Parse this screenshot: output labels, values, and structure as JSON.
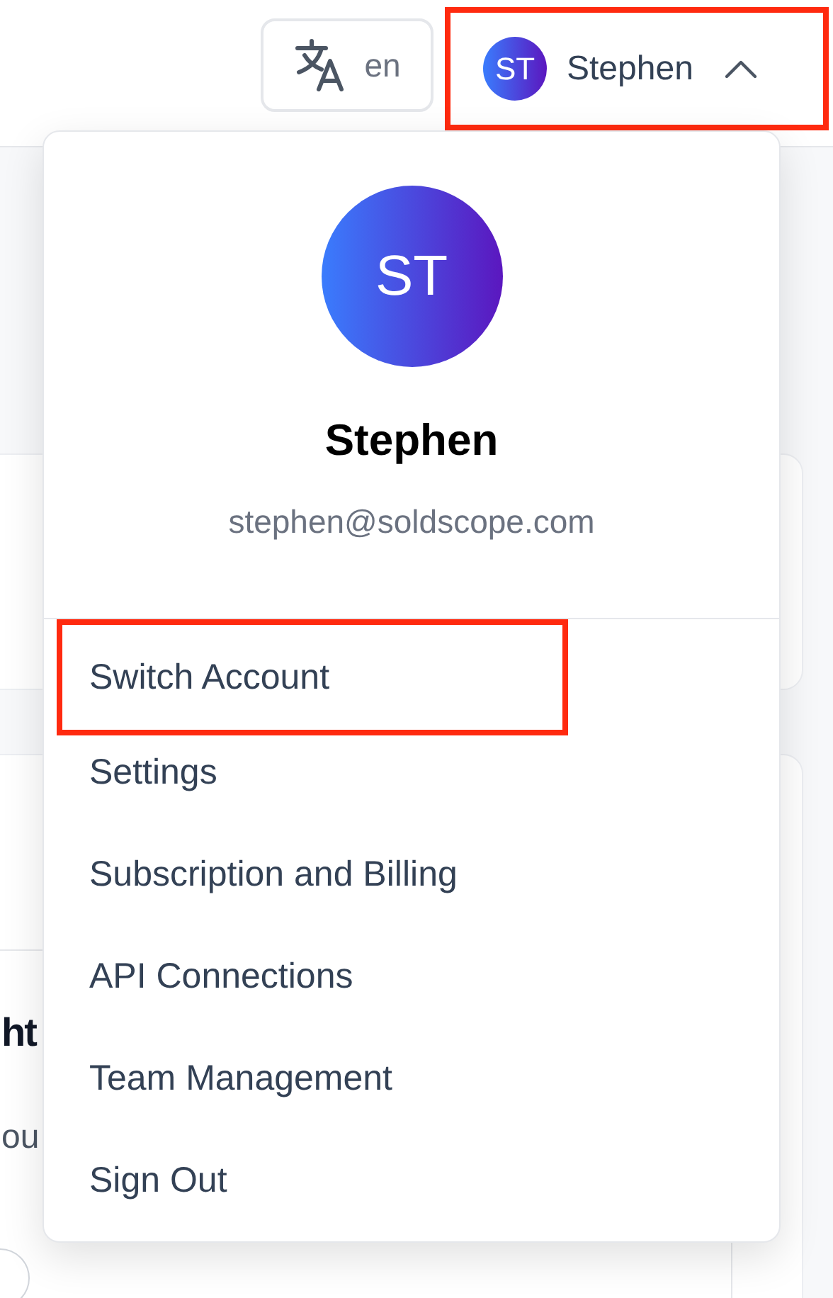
{
  "header": {
    "language": {
      "label": "en"
    },
    "user": {
      "initials": "ST",
      "name": "Stephen",
      "expanded": true,
      "highlighted": true
    }
  },
  "background": {
    "texts": [
      "ht",
      "ou"
    ]
  },
  "dropdown": {
    "initials": "ST",
    "name": "Stephen",
    "email": "stephen@soldscope.com",
    "items": [
      {
        "label": "Switch Account",
        "highlighted": true
      },
      {
        "label": "Settings",
        "highlighted": false
      },
      {
        "label": "Subscription and Billing",
        "highlighted": false
      },
      {
        "label": "API Connections",
        "highlighted": false
      },
      {
        "label": "Team Management",
        "highlighted": false
      },
      {
        "label": "Sign Out",
        "highlighted": false
      }
    ]
  }
}
